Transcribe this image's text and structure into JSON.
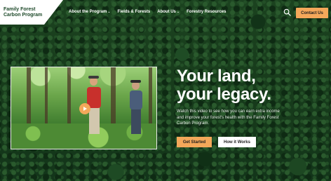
{
  "brand": {
    "line1": "Family Forest",
    "line2": "Carbon Program"
  },
  "nav": {
    "items": [
      {
        "label": "About the Program",
        "has_dropdown": true
      },
      {
        "label": "Fields & Forests",
        "has_dropdown": false
      },
      {
        "label": "About Us",
        "has_dropdown": true
      },
      {
        "label": "Forestry Resources",
        "has_dropdown": false
      }
    ],
    "dropdown_glyph": "⌄",
    "contact_label": "Contact Us",
    "search_icon": "search-icon"
  },
  "hero": {
    "headline_line1": "Your land,",
    "headline_line2": "your legacy.",
    "body": "Watch this video to see how you can earn extra income and improve your forest's health with the Family Forest Carbon Program.",
    "primary_cta": "Get Started",
    "secondary_cta": "How it Works",
    "video_play_icon": "play-icon"
  },
  "colors": {
    "accent": "#f4a85a",
    "brand_green": "#1e4a2a",
    "background": "#15391c"
  }
}
